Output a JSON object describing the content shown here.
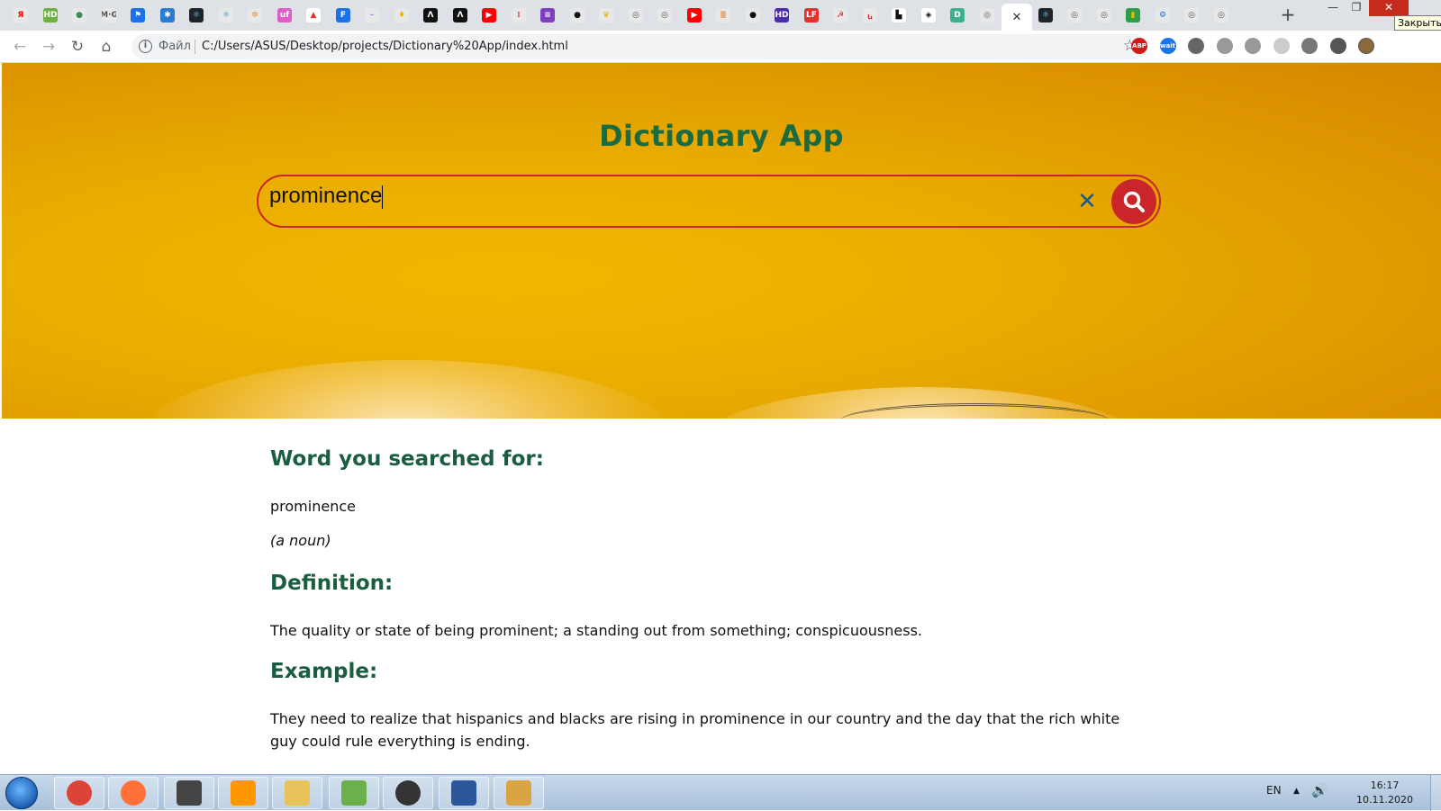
{
  "browser": {
    "tab_favicons": [
      {
        "icon": "yandex-icon",
        "glyph": "Я",
        "color": "#e8e8e8",
        "fg": "#f00"
      },
      {
        "icon": "hd-icon",
        "glyph": "HD",
        "color": "#6fb043",
        "fg": "#fff"
      },
      {
        "icon": "dots-icon",
        "glyph": "●",
        "color": "#e8e8e8",
        "fg": "#3c8b58"
      },
      {
        "icon": "mg-icon",
        "glyph": "M·G",
        "color": "#e8e8e8",
        "fg": "#555"
      },
      {
        "icon": "flag-icon",
        "glyph": "⚑",
        "color": "#1a73e8",
        "fg": "#fff"
      },
      {
        "icon": "asterisk-icon",
        "glyph": "✱",
        "color": "#2a7bd4",
        "fg": "#fff"
      },
      {
        "icon": "react-icon",
        "glyph": "⚛",
        "color": "#20232a",
        "fg": "#61dafb"
      },
      {
        "icon": "react-alt-icon",
        "glyph": "⚛",
        "color": "#e8e8e8",
        "fg": "#1a9bd6"
      },
      {
        "icon": "gear-orange-icon",
        "glyph": "✲",
        "color": "#e8e8e8",
        "fg": "#f08a24"
      },
      {
        "icon": "uf-icon",
        "glyph": "uf",
        "color": "#e05bc5",
        "fg": "#fff"
      },
      {
        "icon": "triangle-icon",
        "glyph": "▲",
        "color": "#fff",
        "fg": "#e0332c"
      },
      {
        "icon": "f-icon",
        "glyph": "F",
        "color": "#1a73e8",
        "fg": "#fff"
      },
      {
        "icon": "dash-icon",
        "glyph": "–",
        "color": "#e8e8e8",
        "fg": "#9a7fd4"
      },
      {
        "icon": "bulb-icon",
        "glyph": "♦",
        "color": "#e8e8e8",
        "fg": "#e6b800"
      },
      {
        "icon": "lambda-icon",
        "glyph": "Λ",
        "color": "#111",
        "fg": "#fff"
      },
      {
        "icon": "lambda-alt-icon",
        "glyph": "Λ",
        "color": "#111",
        "fg": "#fff"
      },
      {
        "icon": "youtube-icon",
        "glyph": "▶",
        "color": "#ff0000",
        "fg": "#fff"
      },
      {
        "icon": "grid-dots-icon",
        "glyph": "⁞",
        "color": "#e8e8e8",
        "fg": "#c33"
      },
      {
        "icon": "stack-icon",
        "glyph": "≡",
        "color": "#7b3fbf",
        "fg": "#fff"
      },
      {
        "icon": "github-icon",
        "glyph": "●",
        "color": "#e8e8e8",
        "fg": "#111"
      },
      {
        "icon": "crown-icon",
        "glyph": "♛",
        "color": "#e8e8e8",
        "fg": "#e6b800"
      },
      {
        "icon": "globe-icon",
        "glyph": "◎",
        "color": "#e8e8e8",
        "fg": "#555"
      },
      {
        "icon": "globe-icon",
        "glyph": "◎",
        "color": "#e8e8e8",
        "fg": "#555"
      },
      {
        "icon": "youtube-icon",
        "glyph": "▶",
        "color": "#ff0000",
        "fg": "#fff"
      },
      {
        "icon": "stackoverflow-icon",
        "glyph": "≣",
        "color": "#e8e8e8",
        "fg": "#f48024"
      },
      {
        "icon": "github-icon",
        "glyph": "●",
        "color": "#e8e8e8",
        "fg": "#111"
      },
      {
        "icon": "hd-purple-icon",
        "glyph": "HD",
        "color": "#4b2bb0",
        "fg": "#fff"
      },
      {
        "icon": "lf-icon",
        "glyph": "LF",
        "color": "#e0332c",
        "fg": "#fff"
      },
      {
        "icon": "emblem-icon",
        "glyph": "☭",
        "color": "#e8e8e8",
        "fg": "#d42020"
      },
      {
        "icon": "signature-icon",
        "glyph": "ꭎ",
        "color": "#e8e8e8",
        "fg": "#d42020"
      },
      {
        "icon": "unsplash-icon",
        "glyph": "▙",
        "color": "#fff",
        "fg": "#111"
      },
      {
        "icon": "codepen-icon",
        "glyph": "◈",
        "color": "#fff",
        "fg": "#111"
      },
      {
        "icon": "d-icon",
        "glyph": "D",
        "color": "#3bb08f",
        "fg": "#fff"
      },
      {
        "icon": "globe-icon",
        "glyph": "◎",
        "color": "#e8e8e8",
        "fg": "#555"
      }
    ],
    "tab_favicons_after": [
      {
        "icon": "react-icon",
        "glyph": "⚛",
        "color": "#20232a",
        "fg": "#61dafb"
      },
      {
        "icon": "globe-icon",
        "glyph": "◎",
        "color": "#e8e8e8",
        "fg": "#555"
      },
      {
        "icon": "globe-icon",
        "glyph": "◎",
        "color": "#e8e8e8",
        "fg": "#555"
      },
      {
        "icon": "bars-icon",
        "glyph": "▮",
        "color": "#2e9e4a",
        "fg": "#e6b800"
      },
      {
        "icon": "gear-blue-icon",
        "glyph": "⚙",
        "color": "#e8e8e8",
        "fg": "#1a73e8"
      },
      {
        "icon": "globe-icon",
        "glyph": "◎",
        "color": "#e8e8e8",
        "fg": "#555"
      },
      {
        "icon": "globe-icon",
        "glyph": "◎",
        "color": "#e8e8e8",
        "fg": "#555"
      }
    ],
    "active_tab_close": "✕",
    "new_tab": "+",
    "window_tooltip": "Закрыть",
    "address_scheme_label": "Файл",
    "address_url": "C:/Users/ASUS/Desktop/projects/Dictionary%20App/index.html",
    "extensions": [
      {
        "icon": "adblock-icon",
        "label": "ABP",
        "color": "#d11a1a"
      },
      {
        "icon": "wait-icon",
        "label": "wait",
        "color": "#1a73e8"
      },
      {
        "icon": "extension-gray-icon",
        "label": "",
        "color": "#666"
      },
      {
        "icon": "pdf-icon",
        "label": "",
        "color": "#999"
      },
      {
        "icon": "translate-icon",
        "label": "",
        "color": "#999"
      },
      {
        "icon": "blank-ext-icon",
        "label": "",
        "color": "#ccc"
      },
      {
        "icon": "camera-ext-icon",
        "label": "",
        "color": "#777"
      },
      {
        "icon": "puzzle-icon",
        "label": "",
        "color": "#555"
      },
      {
        "icon": "profile-avatar",
        "label": "",
        "color": "#8a6a3a"
      }
    ]
  },
  "app": {
    "title": "Dictionary App",
    "search": {
      "value": "prominence",
      "clear_glyph": "✕"
    },
    "results": {
      "word_heading": "Word you searched for:",
      "word": "prominence",
      "word_type": "(a noun)",
      "definition_heading": "Definition:",
      "definition": "The quality or state of being prominent; a standing out from something; conspicuousness.",
      "example_heading": "Example:",
      "example": "They need to realize that hispanics and blacks are rising in prominence in our country and the day that the rich white guy could rule everything is ending."
    },
    "colors": {
      "title": "#1c6a40",
      "heading": "#1b5d40",
      "accent_red": "#c9252b",
      "clear_blue": "#1f5a86",
      "hero_yellow": "#eaae00"
    }
  },
  "taskbar": {
    "apps": [
      {
        "icon": "chrome-icon",
        "color": "#db4437"
      },
      {
        "icon": "firefox-icon",
        "color": "#ff7139"
      },
      {
        "icon": "camera-app-icon",
        "color": "#444"
      },
      {
        "icon": "sublime-icon",
        "color": "#ff9800"
      },
      {
        "icon": "folder-icon",
        "color": "#e8c35a"
      },
      {
        "icon": "gitkraken-icon",
        "color": "#6ab04c"
      },
      {
        "icon": "inkscape-icon",
        "color": "#333"
      },
      {
        "icon": "word-icon",
        "color": "#2b579a"
      },
      {
        "icon": "paint-icon",
        "color": "#d9a441"
      }
    ],
    "language": "EN",
    "time": "16:17",
    "date": "10.11.2020"
  }
}
